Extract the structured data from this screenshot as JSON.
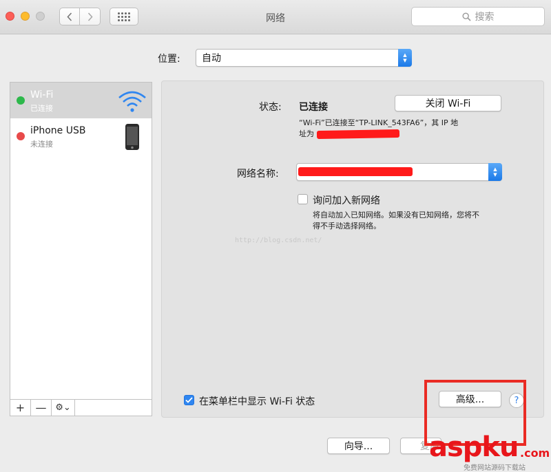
{
  "window": {
    "title": "网络"
  },
  "toolbar": {
    "search_placeholder": "搜索"
  },
  "location": {
    "label": "位置:",
    "value": "自动"
  },
  "sidebar": {
    "services": [
      {
        "name": "Wi-Fi",
        "status": "已连接",
        "dot_color": "#2db84b"
      },
      {
        "name": "iPhone USB",
        "status": "未连接",
        "dot_color": "#e84a4a"
      }
    ],
    "toolbar": {
      "add": "+",
      "remove": "—",
      "gear": "⚙︎⌄"
    }
  },
  "detail": {
    "status_label": "状态:",
    "status_value": "已连接",
    "turn_off_button": "关闭 Wi-Fi",
    "status_desc_line1": "“Wi-Fi”已连接至“TP-LINK_543FA6”，其 IP 地",
    "status_desc_line2": "址为",
    "network_name_label": "网络名称:",
    "ask_join_label": "询问加入新网络",
    "ask_join_desc_line1": "将自动加入已知网络。如果没有已知网络，您将不",
    "ask_join_desc_line2": "得不手动选择网络。",
    "show_menubar_label": "在菜单栏中显示 Wi-Fi 状态",
    "advanced_button": "高级...",
    "help_button": "?"
  },
  "watermark": {
    "url": "http://blog.csdn.net/"
  },
  "footer": {
    "assistant_button": "向导...",
    "revert_button": "复原"
  },
  "logo": {
    "main": "aspku",
    "tld": ".com",
    "sub": "免费网站源码下载站"
  },
  "colors": {
    "accent": "#2f86f0",
    "highlight_box": "#ea2b24",
    "redaction": "#ff1a1a",
    "logo": "#e8161b"
  }
}
